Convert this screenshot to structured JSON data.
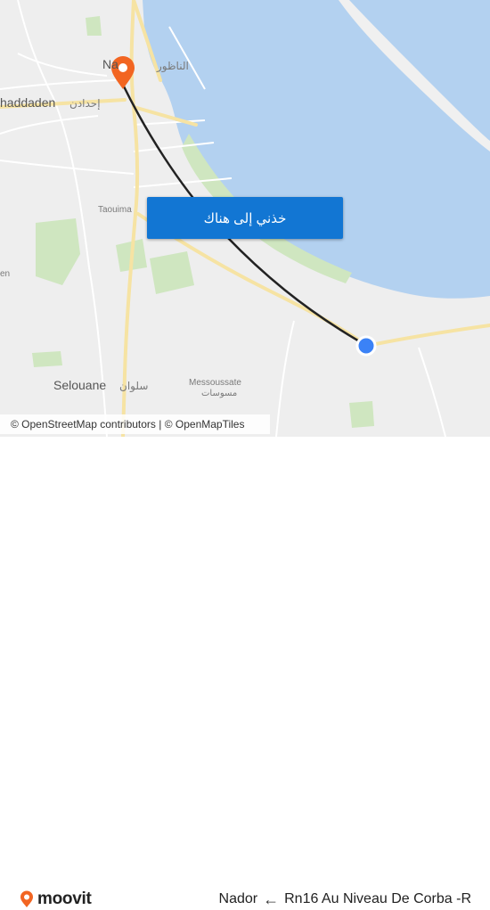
{
  "map": {
    "labels": {
      "nador_latin": "Na",
      "nador_arabic": "الناظور",
      "ihaddaden_latin": "haddaden",
      "ihaddaden_arabic": "إحدادن",
      "taouima": "Taouima",
      "selouane_latin": "Selouane",
      "selouane_arabic": "سلوان",
      "messoussate_latin": "Messoussate",
      "messoussate_arabic": "مسوسات",
      "edge_partial": "en"
    },
    "cta_label": "خذني إلى هناك",
    "attribution": "© OpenStreetMap contributors | © OpenMapTiles",
    "colors": {
      "water": "#b3d1f0",
      "land": "#eeeeee",
      "park": "#cfe6c0",
      "road_major": "#f6e3a3",
      "road_minor": "#ffffff",
      "route_line": "#222222",
      "origin_marker": "#3b82f6",
      "destination_marker": "#f26522",
      "cta_bg": "#1276d3"
    }
  },
  "footer": {
    "brand": "moovit",
    "route": {
      "destination": "Nador",
      "arrow": "←",
      "origin": "Rn16 Au Niveau De Corba -R"
    }
  }
}
